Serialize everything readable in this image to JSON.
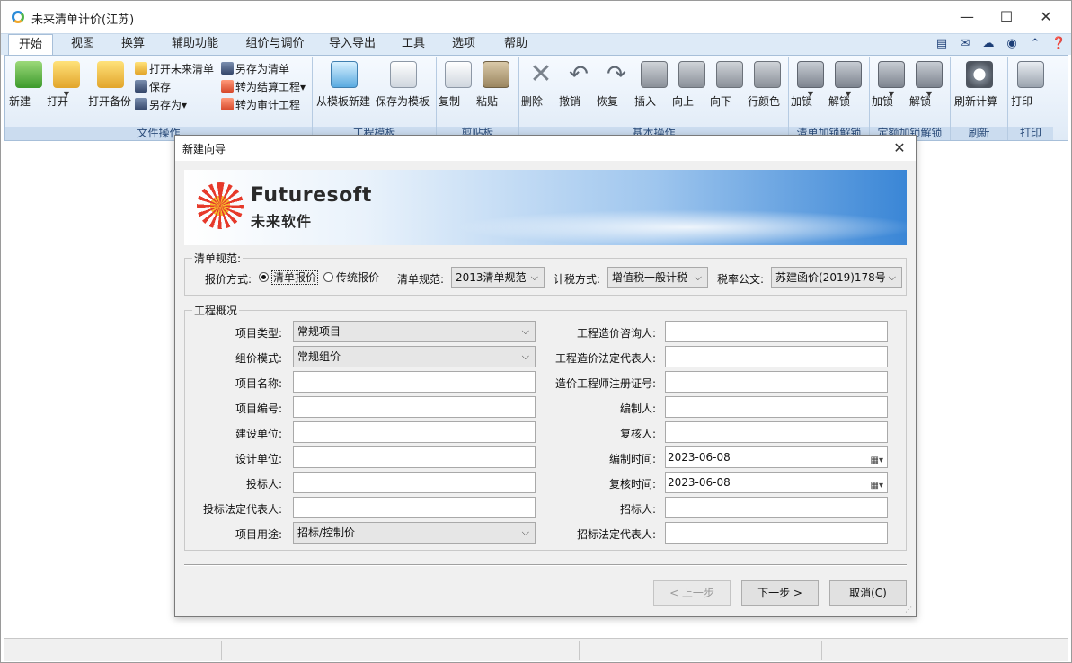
{
  "window": {
    "title": "未来清单计价(江苏)",
    "min": "—",
    "max": "☐",
    "close": "✕"
  },
  "tabs": [
    "开始",
    "视图",
    "换算",
    "辅助功能",
    "组价与调价",
    "导入导出",
    "工具",
    "选项",
    "帮助"
  ],
  "tab_icons": [
    "printer-icon",
    "mail-icon",
    "cloud-icon",
    "user-icon",
    "collapse-icon",
    "help-icon"
  ],
  "ribbon": {
    "file": {
      "label": "文件操作",
      "new": "新建",
      "open": "打开",
      "open_backup": "打开备份",
      "open_future": "打开未来清单",
      "save": "保存",
      "save_as": "另存为▾",
      "save_as_list": "另存为清单",
      "to_settlement": "转为结算工程▾",
      "to_audit": "转为审计工程"
    },
    "template": {
      "label": "工程模板",
      "from_template": "从模板新建",
      "save_as_template": "保存为模板"
    },
    "clipboard": {
      "label": "剪贴板",
      "copy": "复制",
      "paste": "粘贴"
    },
    "basic": {
      "label": "基本操作",
      "delete": "删除",
      "undo": "撤销",
      "redo": "恢复",
      "insert": "插入",
      "up": "向上",
      "down": "向下",
      "row_color": "行颜色"
    },
    "list_lock": {
      "label": "清单加锁解锁",
      "lock": "加锁",
      "unlock": "解锁"
    },
    "quota_lock": {
      "label": "定额加锁解锁",
      "lock": "加锁",
      "unlock": "解锁"
    },
    "refresh": {
      "label": "刷新",
      "recalc": "刷新计算"
    },
    "print": {
      "label": "打印",
      "print": "打印"
    }
  },
  "dialog": {
    "title": "新建向导",
    "close": "✕",
    "banner": {
      "logo_en": "Futuresoft",
      "logo_cn": "未来软件"
    },
    "spec": {
      "legend": "清单规范:",
      "quote_mode_label": "报价方式:",
      "quote_options": [
        "清单报价",
        "传统报价"
      ],
      "quote_selected": "清单报价",
      "spec_label": "清单规范:",
      "spec_value": "2013清单规范",
      "tax_label": "计税方式:",
      "tax_value": "增值税一般计税",
      "rate_label": "税率公文:",
      "rate_value": "苏建函价(2019)178号"
    },
    "overview": {
      "legend": "工程概况",
      "left": [
        {
          "label": "项目类型:",
          "value": "常规项目",
          "type": "combo"
        },
        {
          "label": "组价模式:",
          "value": "常规组价",
          "type": "combo"
        },
        {
          "label": "项目名称:",
          "value": "",
          "type": "text"
        },
        {
          "label": "项目编号:",
          "value": "",
          "type": "text"
        },
        {
          "label": "建设单位:",
          "value": "",
          "type": "text"
        },
        {
          "label": "设计单位:",
          "value": "",
          "type": "text"
        },
        {
          "label": "投标人:",
          "value": "",
          "type": "text"
        },
        {
          "label": "投标法定代表人:",
          "value": "",
          "type": "text"
        },
        {
          "label": "项目用途:",
          "value": "招标/控制价",
          "type": "combo"
        }
      ],
      "right": [
        {
          "label": "工程造价咨询人:",
          "value": "",
          "type": "text"
        },
        {
          "label": "工程造价法定代表人:",
          "value": "",
          "type": "text"
        },
        {
          "label": "造价工程师注册证号:",
          "value": "",
          "type": "text"
        },
        {
          "label": "编制人:",
          "value": "",
          "type": "text"
        },
        {
          "label": "复核人:",
          "value": "",
          "type": "text"
        },
        {
          "label": "编制时间:",
          "value": "2023-06-08",
          "type": "date"
        },
        {
          "label": "复核时间:",
          "value": "2023-06-08",
          "type": "date"
        },
        {
          "label": "招标人:",
          "value": "",
          "type": "text"
        },
        {
          "label": "招标法定代表人:",
          "value": "",
          "type": "text"
        }
      ]
    },
    "buttons": {
      "prev": "< 上一步",
      "next": "下一步 >",
      "cancel": "取消(C)"
    }
  }
}
